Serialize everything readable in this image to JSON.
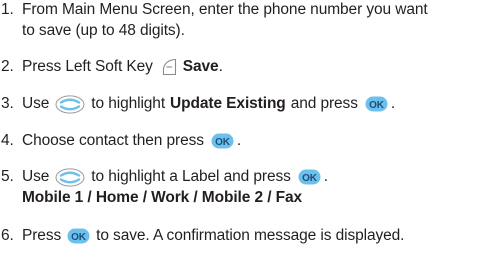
{
  "steps": [
    {
      "number": "1.",
      "line1": "From Main Menu Screen, enter the phone number you want",
      "line2": "to save (up to 48 digits)."
    },
    {
      "number": "2.",
      "before": "Press Left Soft Key",
      "bold": "Save",
      "after": "."
    },
    {
      "number": "3.",
      "before": "Use",
      "middle": "to highlight",
      "bold": "Update Existing",
      "after": "and press",
      "end": "."
    },
    {
      "number": "4.",
      "before": "Choose contact then press",
      "end": "."
    },
    {
      "number": "5.",
      "before": "Use",
      "middle": "to highlight a Label and press",
      "end": ".",
      "line2_bold": "Mobile 1 / Home / Work / Mobile 2 / Fax"
    },
    {
      "number": "6.",
      "before": "Press",
      "after": "to save.  A confirmation message is displayed."
    }
  ],
  "icons": {
    "ok_label": "OK",
    "ok_color": "#6cc1ec",
    "nav_color": "#6cc1ec"
  }
}
